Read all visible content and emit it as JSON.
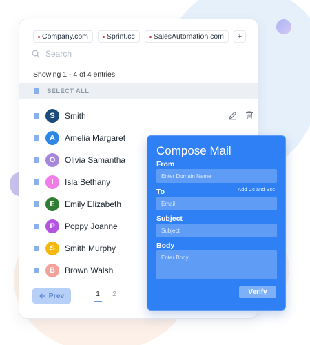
{
  "chips": [
    {
      "label": "Company.com"
    },
    {
      "label": "Sprint.cc"
    },
    {
      "label": "SalesAutomation.com"
    }
  ],
  "add_chip_label": "+",
  "search": {
    "placeholder": "Search",
    "icon": "search-icon"
  },
  "showing_text": "Showing 1 - 4 of 4 entries",
  "select_all_label": "SELECT ALL",
  "contacts": [
    {
      "initial": "S",
      "name": "Smith",
      "color": "#1c4a7a",
      "actions": [
        "edit-icon",
        "trash-icon"
      ]
    },
    {
      "initial": "A",
      "name": "Amelia Margaret",
      "color": "#2e86e6"
    },
    {
      "initial": "O",
      "name": "Olivia Samantha",
      "color": "#a687dc"
    },
    {
      "initial": "I",
      "name": "Isla Bethany",
      "color": "#f07ee6"
    },
    {
      "initial": "E",
      "name": "Emily Elizabeth",
      "color": "#2e7d32"
    },
    {
      "initial": "P",
      "name": "Poppy Joanne",
      "color": "#b455e0"
    },
    {
      "initial": "S",
      "name": "Smith Murphy",
      "color": "#f6b70f"
    },
    {
      "initial": "B",
      "name": "Brown Walsh",
      "color": "#f3a29b"
    }
  ],
  "pagination": {
    "prev_label": "Prev",
    "pages": [
      "1",
      "2"
    ],
    "active_page": "1"
  },
  "compose": {
    "title": "Compose Mail",
    "from_label": "From",
    "from_placeholder": "Enter Domain Name",
    "to_label": "To",
    "add_cc_label": "Add Cc and Bcc",
    "to_placeholder": "Email",
    "subject_label": "Subject",
    "subject_placeholder": "Subject",
    "body_label": "Body",
    "body_placeholder": "Enter Body",
    "verify_label": "Verify"
  },
  "colors": {
    "accent": "#2f7ff5",
    "checkbox": "#8ab0ec",
    "prev_button": "#b7d0f7"
  }
}
